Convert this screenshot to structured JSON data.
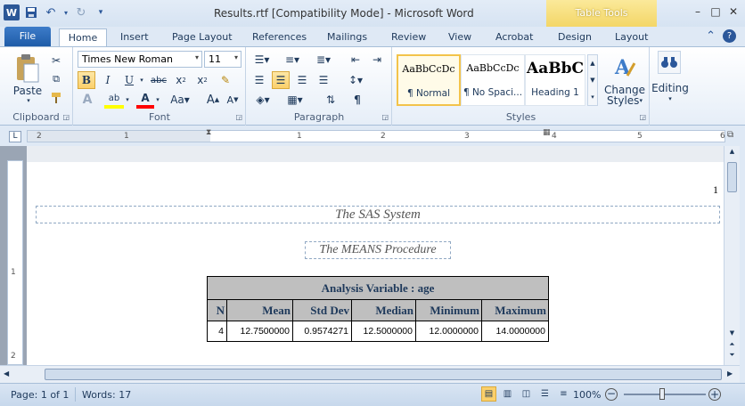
{
  "window": {
    "title": "Results.rtf [Compatibility Mode] - Microsoft Word",
    "contextual_tab_group": "Table Tools"
  },
  "tabs": [
    "File",
    "Home",
    "Insert",
    "Page Layout",
    "References",
    "Mailings",
    "Review",
    "View",
    "Acrobat",
    "Design",
    "Layout"
  ],
  "ribbon": {
    "clipboard": {
      "label": "Clipboard",
      "paste_label": "Paste"
    },
    "font": {
      "label": "Font",
      "font_name": "Times New Roman",
      "font_size": "11"
    },
    "paragraph": {
      "label": "Paragraph"
    },
    "styles": {
      "label": "Styles",
      "items": [
        {
          "sample": "AaBbCcDc",
          "name": "¶ Normal"
        },
        {
          "sample": "AaBbCcDc",
          "name": "¶ No Spaci..."
        },
        {
          "sample": "AaBbC",
          "name": "Heading 1"
        }
      ],
      "change_styles_line1": "Change",
      "change_styles_line2": "Styles"
    },
    "editing": {
      "label": "Editing"
    }
  },
  "ruler": {
    "ticks": [
      "2",
      "1",
      "1",
      "2",
      "3",
      "4",
      "5",
      "6"
    ]
  },
  "document": {
    "page_number": "1",
    "title": "The SAS System",
    "procedure": "The MEANS Procedure",
    "table": {
      "caption": "Analysis Variable : age",
      "headers": [
        "N",
        "Mean",
        "Std Dev",
        "Median",
        "Minimum",
        "Maximum"
      ],
      "rows": [
        [
          "4",
          "12.7500000",
          "0.9574271",
          "12.5000000",
          "12.0000000",
          "14.0000000"
        ]
      ]
    }
  },
  "status_bar": {
    "page": "Page: 1 of 1",
    "words": "Words: 17",
    "zoom": "100%"
  },
  "colors": {
    "ribbon_accent": "#2b579a",
    "table_tools": "#f3d667",
    "table_header_bg": "#bfbfbf"
  }
}
